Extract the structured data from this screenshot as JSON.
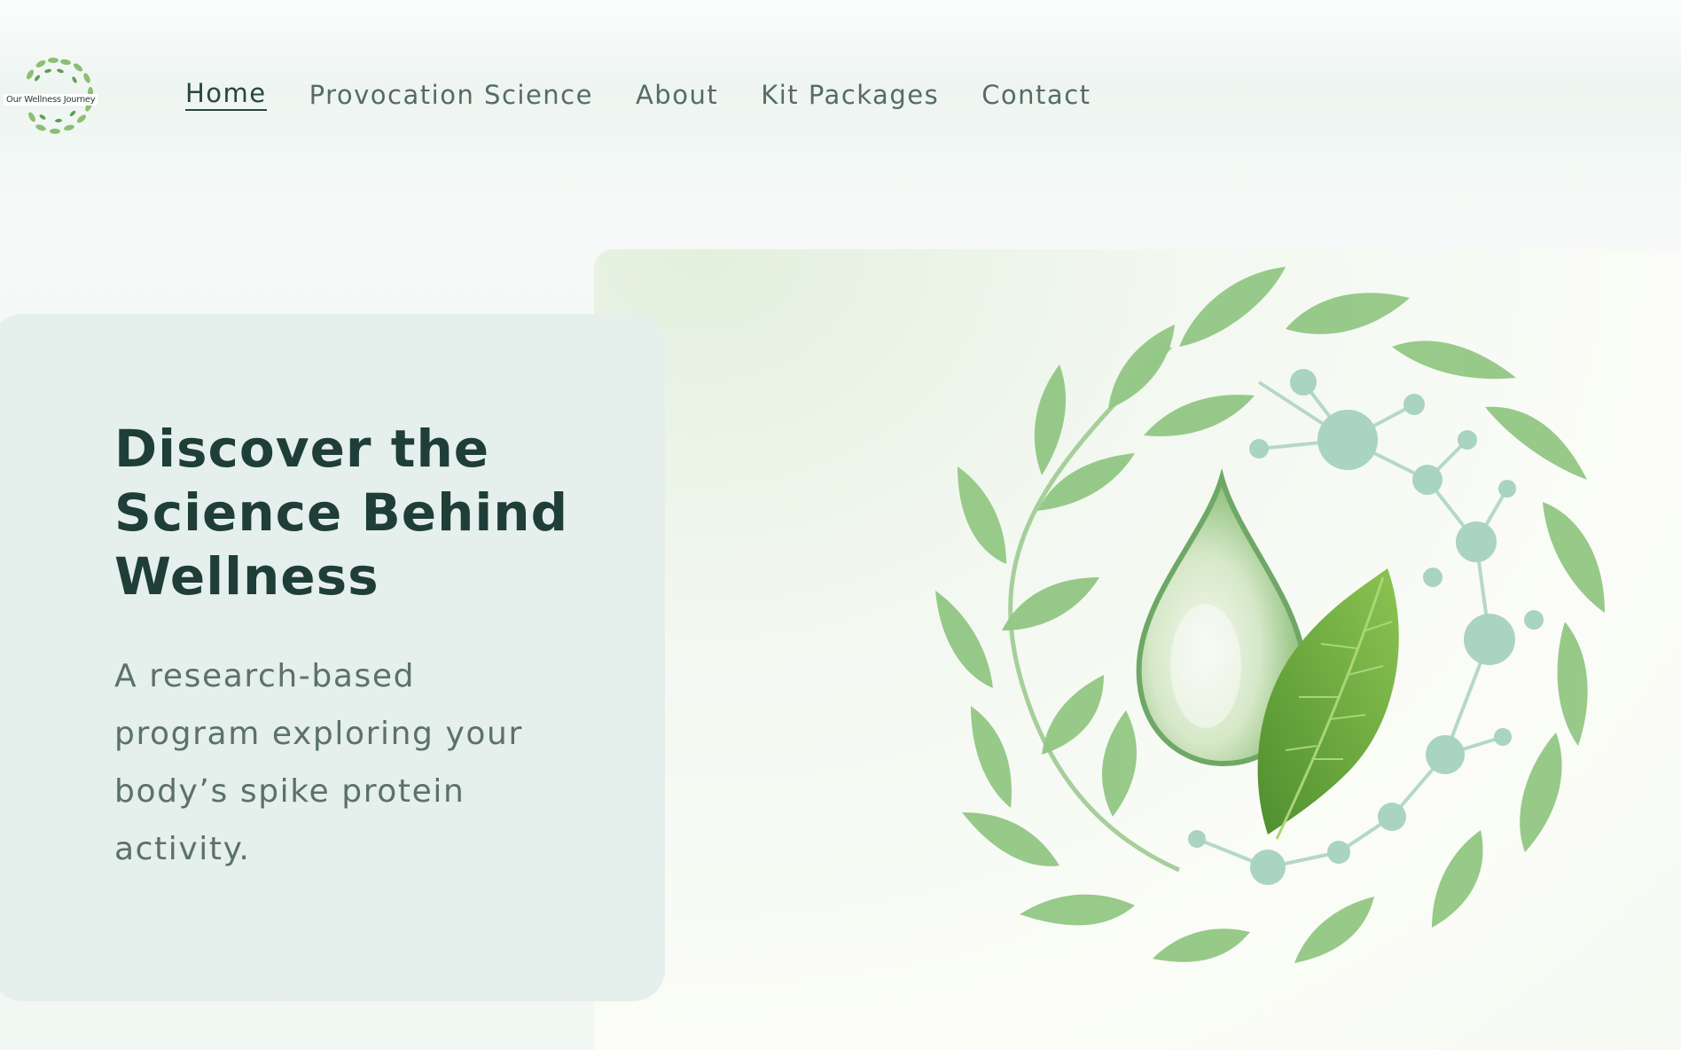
{
  "brand": {
    "logo_text": "Our Wellness Journey"
  },
  "nav": {
    "items": [
      {
        "label": "Home",
        "active": true
      },
      {
        "label": "Provocation Science",
        "active": false
      },
      {
        "label": "About",
        "active": false
      },
      {
        "label": "Kit Packages",
        "active": false
      },
      {
        "label": "Contact",
        "active": false
      }
    ]
  },
  "hero": {
    "title": "Discover the Science Behind Wellness",
    "subtitle": "A research-based program exploring your body’s spike protein activity."
  },
  "colors": {
    "heading": "#1e3e37",
    "body_text": "#5b716b",
    "card_bg": "#e5efec",
    "leaf_green": "#8fc47e",
    "molecule": "#a9d3c3"
  },
  "icons": {
    "hero_illustration": "water-drop-leaf-wreath-icon",
    "logo": "leaf-ring-logo-icon"
  }
}
